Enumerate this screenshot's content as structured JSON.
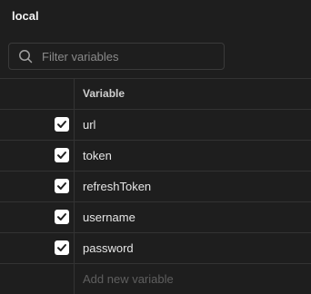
{
  "environment": {
    "title": "local"
  },
  "search": {
    "placeholder": "Filter variables",
    "value": ""
  },
  "table": {
    "header": {
      "variable_label": "Variable"
    },
    "rows": [
      {
        "name": "url",
        "checked": true
      },
      {
        "name": "token",
        "checked": true
      },
      {
        "name": "refreshToken",
        "checked": true
      },
      {
        "name": "username",
        "checked": true
      },
      {
        "name": "password",
        "checked": true
      }
    ],
    "add_new_placeholder": "Add new variable"
  },
  "icons": {
    "search": "search-icon",
    "check": "check-icon"
  },
  "colors": {
    "background": "#1e1e1e",
    "border": "#333333",
    "text": "#e6e6e6",
    "placeholder": "#8a8a8a",
    "checkbox_fill": "#ffffff"
  }
}
